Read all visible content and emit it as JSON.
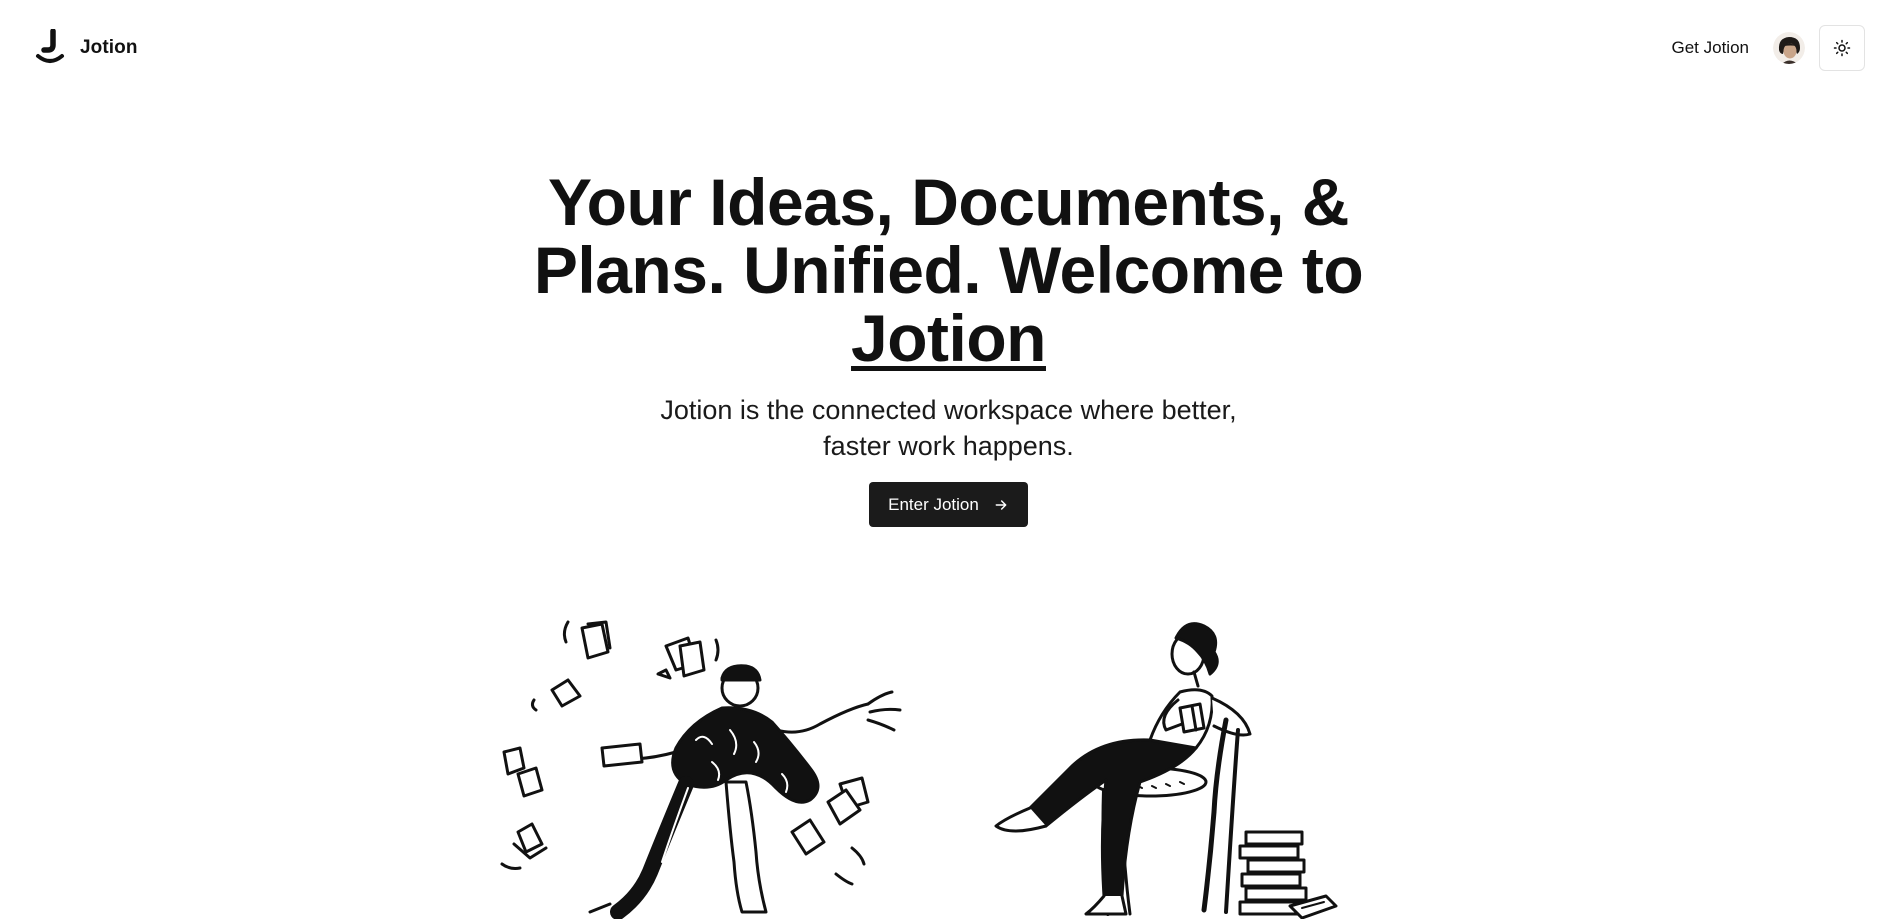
{
  "brand": {
    "name": "Jotion",
    "logo_icon": "jotion-logo-icon"
  },
  "nav": {
    "get_link_label": "Get Jotion",
    "avatar_icon": "user-avatar",
    "theme_toggle_icon": "sun-icon"
  },
  "hero": {
    "title_part1": "Your Ideas, Documents, & Plans. Unified. Welcome to ",
    "title_brand": "Jotion",
    "subtitle": "Jotion is the connected workspace where better, faster work happens.",
    "cta_label": "Enter Jotion",
    "cta_icon": "arrow-right-icon"
  },
  "colors": {
    "background": "#ffffff",
    "text": "#111111",
    "cta_background": "#1b1b1b",
    "cta_text": "#ffffff"
  }
}
